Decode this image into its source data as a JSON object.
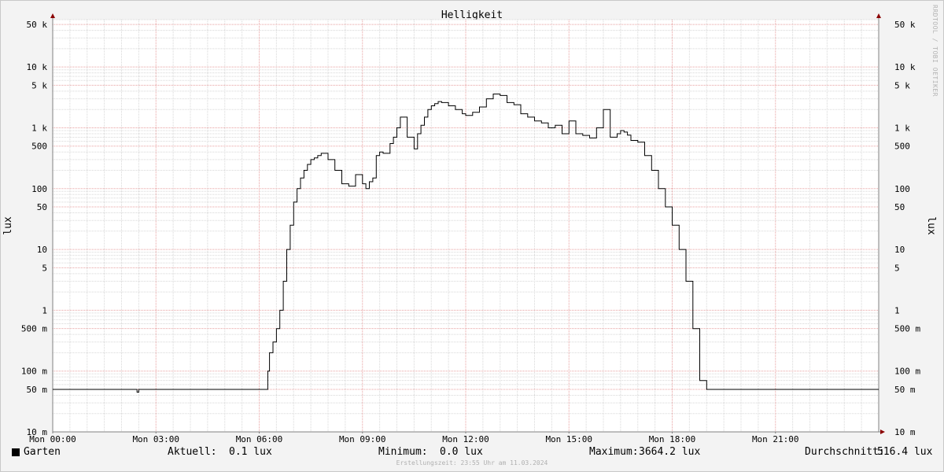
{
  "chart_data": {
    "type": "line",
    "title": "Helligkeit",
    "ylabel": "lux",
    "yscale": "log",
    "ylim": [
      0.01,
      60000
    ],
    "x_unit": "hours",
    "xlim": [
      0,
      24
    ],
    "x_ticks": [
      {
        "value": 0,
        "label": "Mon 00:00"
      },
      {
        "value": 3,
        "label": "Mon 03:00"
      },
      {
        "value": 6,
        "label": "Mon 06:00"
      },
      {
        "value": 9,
        "label": "Mon 09:00"
      },
      {
        "value": 12,
        "label": "Mon 12:00"
      },
      {
        "value": 15,
        "label": "Mon 15:00"
      },
      {
        "value": 18,
        "label": "Mon 18:00"
      },
      {
        "value": 21,
        "label": "Mon 21:00"
      }
    ],
    "y_ticks": [
      {
        "value": 0.01,
        "label": "10 m"
      },
      {
        "value": 0.05,
        "label": "50 m"
      },
      {
        "value": 0.1,
        "label": "100 m"
      },
      {
        "value": 0.5,
        "label": "500 m"
      },
      {
        "value": 1,
        "label": "1"
      },
      {
        "value": 5,
        "label": "5"
      },
      {
        "value": 10,
        "label": "10"
      },
      {
        "value": 50,
        "label": "50"
      },
      {
        "value": 100,
        "label": "100"
      },
      {
        "value": 500,
        "label": "500"
      },
      {
        "value": 1000,
        "label": "1 k"
      },
      {
        "value": 5000,
        "label": "5 k"
      },
      {
        "value": 10000,
        "label": "10 k"
      },
      {
        "value": 50000,
        "label": "50 k"
      }
    ],
    "grid": true,
    "series": [
      {
        "name": "Garten",
        "color": "#000000",
        "x": [
          0,
          2.4,
          2.45,
          2.5,
          6.2,
          6.25,
          6.3,
          6.4,
          6.5,
          6.6,
          6.7,
          6.8,
          6.9,
          7.0,
          7.1,
          7.2,
          7.3,
          7.4,
          7.5,
          7.6,
          7.7,
          7.8,
          8.0,
          8.2,
          8.4,
          8.6,
          8.8,
          9.0,
          9.1,
          9.2,
          9.3,
          9.4,
          9.5,
          9.6,
          9.8,
          9.9,
          10.0,
          10.1,
          10.3,
          10.5,
          10.6,
          10.7,
          10.8,
          10.9,
          11.0,
          11.1,
          11.2,
          11.3,
          11.5,
          11.7,
          11.9,
          12.0,
          12.2,
          12.4,
          12.6,
          12.8,
          13.0,
          13.2,
          13.4,
          13.6,
          13.8,
          14.0,
          14.2,
          14.4,
          14.6,
          14.8,
          15.0,
          15.2,
          15.4,
          15.6,
          15.8,
          16.0,
          16.2,
          16.4,
          16.5,
          16.6,
          16.7,
          16.8,
          17.0,
          17.2,
          17.4,
          17.6,
          17.8,
          18.0,
          18.2,
          18.4,
          18.6,
          18.8,
          19.0,
          19.2,
          19.3,
          19.5,
          24
        ],
        "values": [
          0.05,
          0.05,
          0.045,
          0.05,
          0.05,
          0.1,
          0.2,
          0.3,
          0.5,
          1.0,
          3.0,
          10.0,
          25.0,
          60.0,
          100.0,
          150.0,
          200.0,
          250.0,
          300.0,
          320.0,
          350.0,
          380.0,
          300.0,
          200.0,
          120.0,
          110.0,
          170.0,
          120.0,
          100.0,
          130.0,
          150.0,
          350.0,
          400.0,
          380.0,
          550.0,
          700.0,
          1000.0,
          1500.0,
          700.0,
          450.0,
          800.0,
          1100.0,
          1500.0,
          2000.0,
          2300.0,
          2500.0,
          2700.0,
          2600.0,
          2300.0,
          2000.0,
          1700.0,
          1600.0,
          1800.0,
          2200.0,
          3000.0,
          3600.0,
          3400.0,
          2600.0,
          2400.0,
          1700.0,
          1500.0,
          1300.0,
          1200.0,
          1000.0,
          1100.0,
          800.0,
          1300.0,
          800.0,
          750.0,
          680.0,
          1000.0,
          2000.0,
          700.0,
          800.0,
          900.0,
          850.0,
          760.0,
          620.0,
          580.0,
          350.0,
          200.0,
          100.0,
          50.0,
          25.0,
          10.0,
          3.0,
          0.5,
          0.07,
          0.05,
          0.05,
          0.05,
          0.05,
          0.05
        ]
      }
    ]
  },
  "legend": {
    "series_name": "Garten",
    "current_label": "Aktuell:",
    "current_value": "0.1 lux",
    "min_label": "Minimum:",
    "min_value": "0.0 lux",
    "max_label": "Maximum:",
    "max_value": "3664.2 lux",
    "avg_label": "Durchschnitt:",
    "avg_value": "516.4 lux"
  },
  "footer": "Erstellungszeit: 23:55 Uhr am 11.03.2024",
  "watermark": "RRDTOOL / TOBI OETIKER",
  "colors": {
    "background": "#f3f3f3",
    "plot_background": "#ffffff",
    "major_grid": "#e8a0a0",
    "minor_grid": "#d8d8d8",
    "axis": "#808080",
    "arrow": "#8b0000",
    "line": "#000000"
  }
}
